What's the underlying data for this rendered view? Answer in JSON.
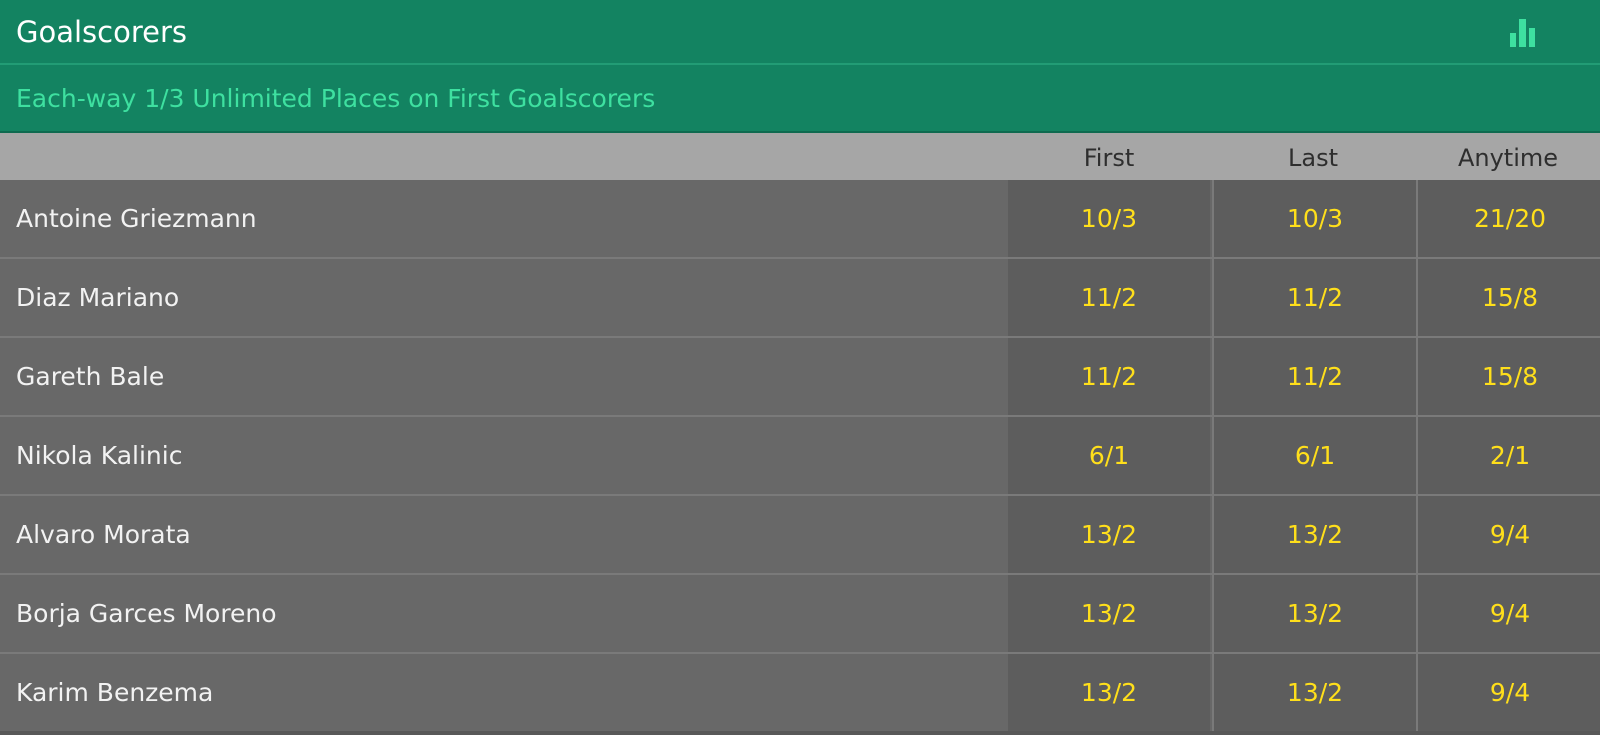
{
  "header": {
    "title": "Goalscorers",
    "stats_icon": "bar-chart-icon"
  },
  "subheader": {
    "text": "Each-way 1/3 Unlimited Places on First Goalscorers"
  },
  "columns": [
    "First",
    "Last",
    "Anytime"
  ],
  "rows": [
    {
      "player": "Antoine Griezmann",
      "first": "10/3",
      "last": "10/3",
      "anytime": "21/20"
    },
    {
      "player": "Diaz Mariano",
      "first": "11/2",
      "last": "11/2",
      "anytime": "15/8"
    },
    {
      "player": "Gareth Bale",
      "first": "11/2",
      "last": "11/2",
      "anytime": "15/8"
    },
    {
      "player": "Nikola Kalinic",
      "first": "6/1",
      "last": "6/1",
      "anytime": "2/1"
    },
    {
      "player": "Alvaro Morata",
      "first": "13/2",
      "last": "13/2",
      "anytime": "9/4"
    },
    {
      "player": "Borja Garces Moreno",
      "first": "13/2",
      "last": "13/2",
      "anytime": "9/4"
    },
    {
      "player": "Karim Benzema",
      "first": "13/2",
      "last": "13/2",
      "anytime": "9/4"
    }
  ],
  "colors": {
    "header_bg": "#138361",
    "subtitle_text": "#3ee0a0",
    "odds_text": "#ffdf1b",
    "column_header_bg": "#a6a6a6"
  }
}
